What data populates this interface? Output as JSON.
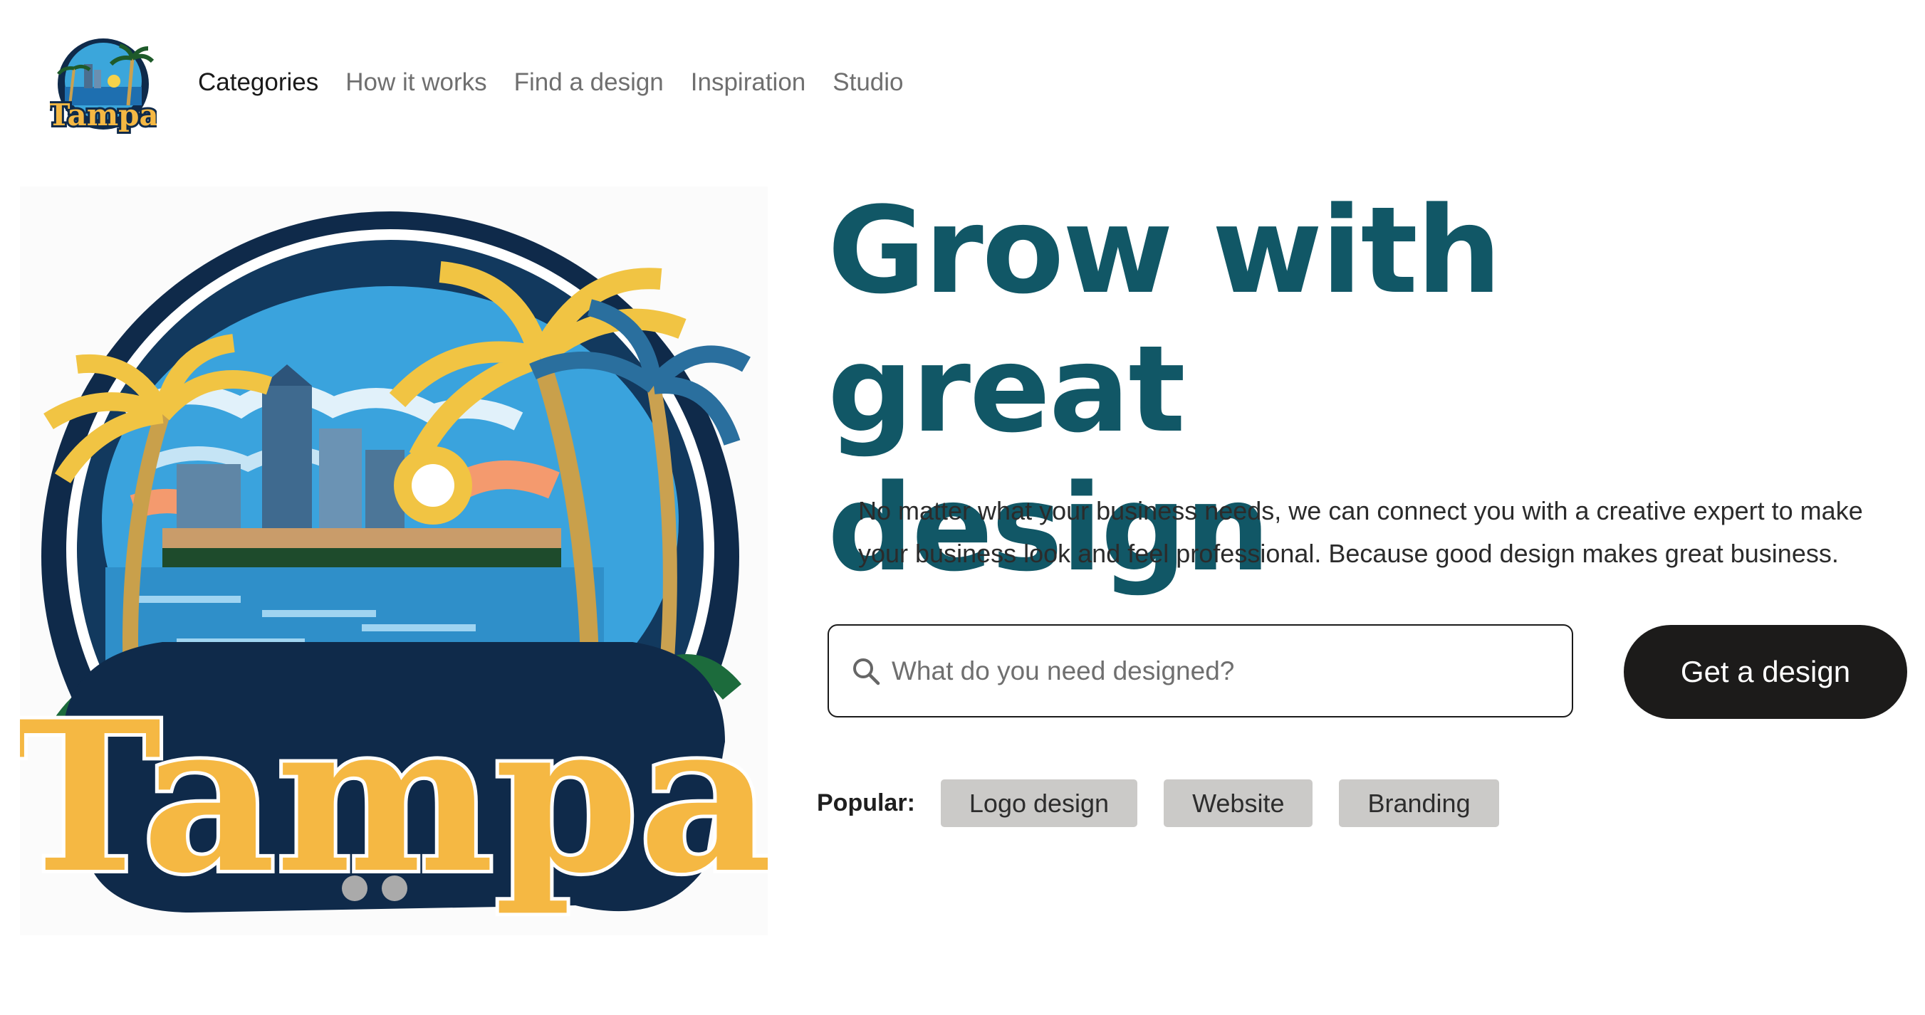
{
  "header": {
    "logo_text": "Tampa",
    "nav": [
      {
        "label": "Categories",
        "active": true
      },
      {
        "label": "How it works",
        "active": false
      },
      {
        "label": "Find a design",
        "active": false
      },
      {
        "label": "Inspiration",
        "active": false
      },
      {
        "label": "Studio",
        "active": false
      }
    ]
  },
  "hero": {
    "image_text": "Tampa",
    "carousel_dots": 2,
    "headline_line1": "Grow with great",
    "headline_line2": "design",
    "subtitle": "No matter what your business needs, we can connect you with a creative expert to make your business look and feel professional. Because good design makes great business.",
    "search_placeholder": "What do you need designed?",
    "cta_label": "Get a design",
    "popular_label": "Popular:",
    "popular_tags": [
      "Logo design",
      "Website",
      "Branding"
    ]
  },
  "colors": {
    "headline": "#115766",
    "cta_bg": "#1c1b1a",
    "tag_bg": "#cbcac8",
    "logo_navy": "#0f2a4a",
    "logo_gold": "#f5b843"
  },
  "icons": [
    "search-icon",
    "palm-tree-icon"
  ]
}
